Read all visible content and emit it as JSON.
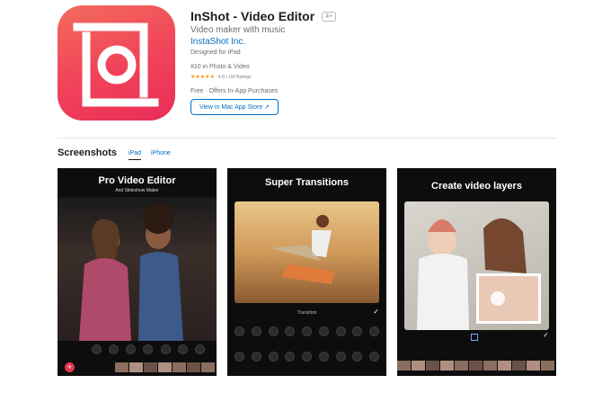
{
  "app": {
    "title": "InShot - Video Editor",
    "age_rating": "4+",
    "subtitle": "Video maker with music",
    "developer": "InstaShot Inc.",
    "designed_for": "Designed for iPad",
    "rank": "#10 in Photo & Video",
    "stars": "★★★★★",
    "rating_text": "4.8 • 1M Ratings",
    "price": "Free · Offers In-App Purchases",
    "mac_store_button": "View in Mac App Store ↗"
  },
  "screenshots": {
    "heading": "Screenshots",
    "tabs": [
      {
        "label": "iPad",
        "selected": true
      },
      {
        "label": "iPhone",
        "selected": false
      }
    ],
    "items": [
      {
        "caption": "Pro Video Editor",
        "subcaption": "And Slideshow Maker"
      },
      {
        "caption": "Super Transitions",
        "bar_label": "Transition"
      },
      {
        "caption": "Create video layers"
      }
    ]
  },
  "colors": {
    "link_blue": "#0070c9",
    "star_orange": "#ff9500",
    "icon_gradient_top": "#f36b5c",
    "icon_gradient_bottom": "#ea2d57"
  },
  "icons": [
    "inshot-logo-icon",
    "external-arrow-icon",
    "add-icon",
    "checkmark-icon"
  ]
}
